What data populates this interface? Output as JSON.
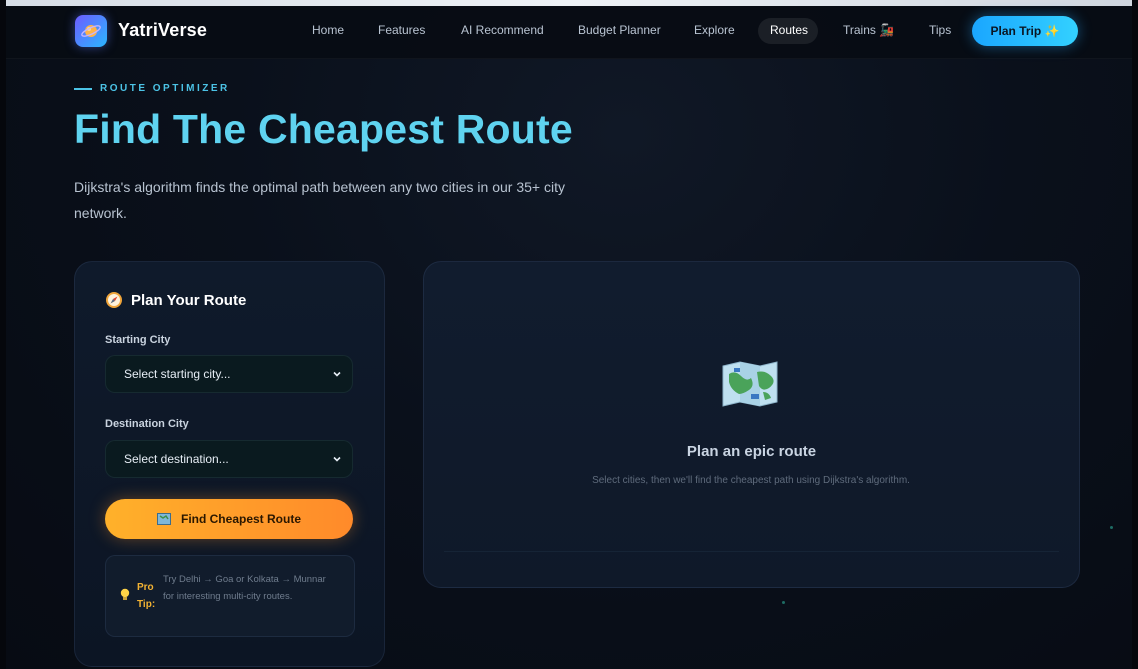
{
  "nav": {
    "brand": "YatriVerse",
    "links": [
      {
        "label": "Home"
      },
      {
        "label": "Features"
      },
      {
        "label": "AI Recommend"
      },
      {
        "label": "Budget Planner"
      },
      {
        "label": "Explore"
      },
      {
        "label": "Routes",
        "active": true
      },
      {
        "label": "Trains 🚂"
      },
      {
        "label": "Tips"
      }
    ],
    "cta": "Plan Trip ✨"
  },
  "hero": {
    "eyebrow": "ROUTE OPTIMIZER",
    "title": "Find The Cheapest Route",
    "description": "Dijkstra's algorithm finds the optimal path between any two cities in our 35+ city network."
  },
  "planner": {
    "title": "Plan Your Route",
    "start_label": "Starting City",
    "start_value": "Select starting city...",
    "dest_label": "Destination City",
    "dest_value": "Select destination...",
    "button": "Find Cheapest Route",
    "tip_label": "Pro Tip:",
    "tip_text": "Try Delhi → Goa or Kolkata → Munnar for interesting multi-city routes."
  },
  "result": {
    "title": "Plan an epic route",
    "description": "Select cities, then we'll find the cheapest path using Dijkstra's algorithm."
  },
  "colors": {
    "accent": "#5fd3f0",
    "cta_blue": "#1aa6ff",
    "cta_orange": "#ff9a2a",
    "tip_label": "#f2b233"
  }
}
